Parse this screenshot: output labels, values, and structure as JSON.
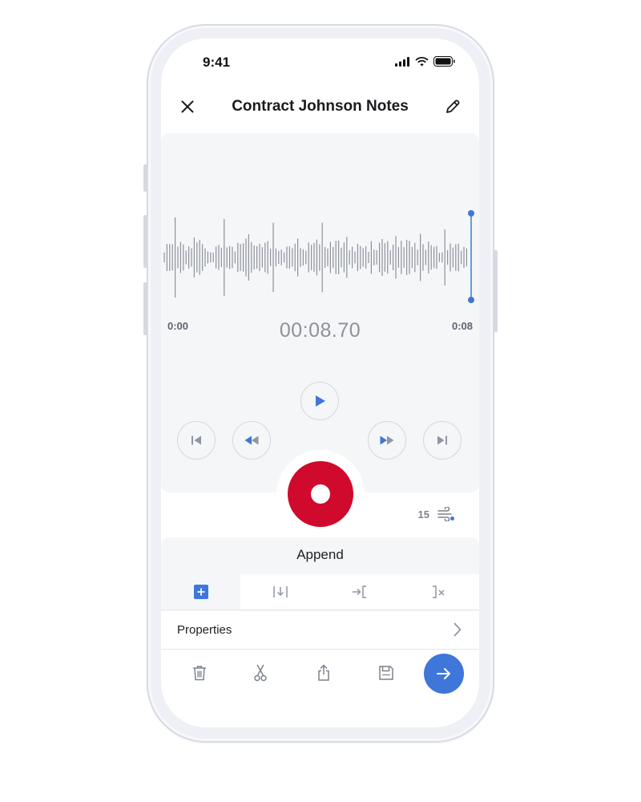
{
  "status": {
    "time": "9:41"
  },
  "header": {
    "title": "Contract Johnson Notes"
  },
  "player": {
    "start_time": "0:00",
    "end_time": "0:08",
    "timer": "00:08.70",
    "speed_value": "15"
  },
  "append": {
    "title": "Append",
    "modes": [
      "add",
      "insert",
      "overwrite-from",
      "trim"
    ],
    "active_mode": "add"
  },
  "properties": {
    "label": "Properties"
  },
  "colors": {
    "accent": "#3f76d9",
    "record": "#cf0a2c",
    "wave": "#8d929b",
    "playhead": "#3f76d9"
  },
  "icons": [
    "close-icon",
    "pencil-icon",
    "play-icon",
    "skip-start-icon",
    "rewind-icon",
    "fast-forward-icon",
    "skip-end-icon",
    "record-icon",
    "speed-icon",
    "add-icon",
    "insert-icon",
    "overwrite-icon",
    "trim-icon",
    "chevron-right-icon",
    "trash-icon",
    "scissors-icon",
    "share-icon",
    "save-icon",
    "arrow-right-icon"
  ]
}
